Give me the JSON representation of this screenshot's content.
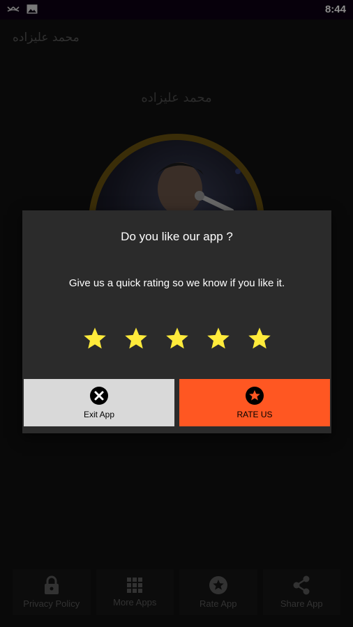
{
  "status_bar": {
    "time": "8:44",
    "icons": [
      "missed-call-icon",
      "image-icon"
    ]
  },
  "app_bar": {
    "title": "محمد علیزاده"
  },
  "main": {
    "artist_name": "محمد علیزاده"
  },
  "dialog": {
    "title": "Do you like our app ?",
    "message": "Give us a quick rating so we know if you like it.",
    "star_count": 5,
    "star_color": "#ffeb3b",
    "exit_label": "Exit App",
    "rate_label": "RATE US",
    "rate_color": "#ff5722"
  },
  "bottom_nav": {
    "items": [
      {
        "label": "Privacy Policy",
        "icon": "lock-icon"
      },
      {
        "label": "More Apps",
        "icon": "grid-icon"
      },
      {
        "label": "Rate App",
        "icon": "star-circle-icon"
      },
      {
        "label": "Share App",
        "icon": "share-icon"
      }
    ]
  }
}
